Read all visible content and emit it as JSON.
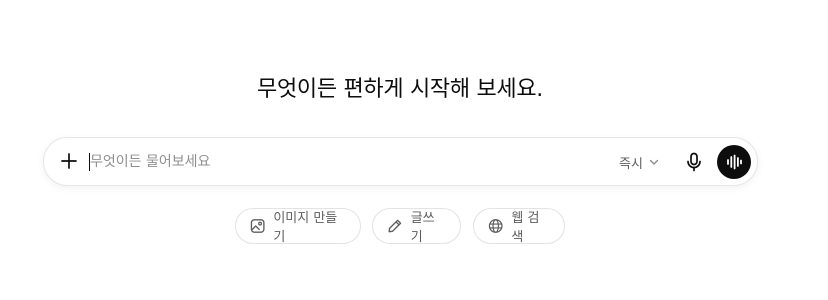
{
  "headline": "무엇이든 편하게 시작해 보세요.",
  "composer": {
    "placeholder": "무엇이든 물어보세요",
    "value": "",
    "model_label": "즉시"
  },
  "icons": {
    "attach": "plus-icon",
    "model_dropdown": "chevron-down-icon",
    "dictate": "microphone-icon",
    "voice_mode": "audio-waveform-icon",
    "create_image": "image-icon",
    "write": "pencil-icon",
    "web_search": "globe-icon"
  },
  "suggestions": [
    {
      "label": "이미지 만들기"
    },
    {
      "label": "글쓰기"
    },
    {
      "label": "웹 검색"
    }
  ],
  "colors": {
    "text": "#0d0d0d",
    "muted": "#5d5d5d",
    "placeholder": "#8f8f8f",
    "border": "#e6e6e6",
    "voice_button": "#0d0d0d"
  }
}
